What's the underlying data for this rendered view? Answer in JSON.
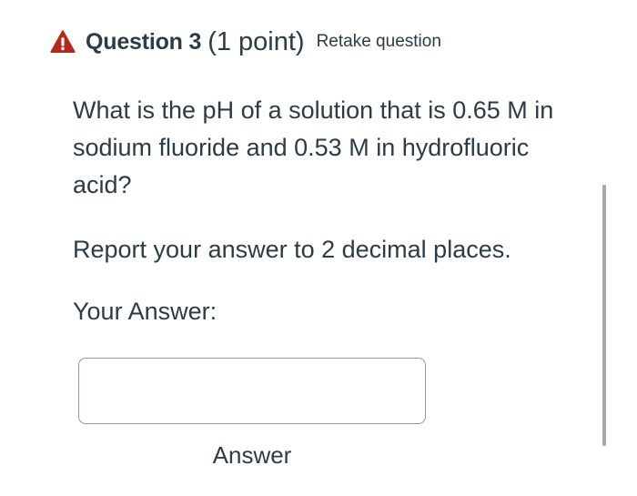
{
  "header": {
    "icon": "warning-triangle-icon",
    "icon_color": "#b12a1b",
    "title": "Question 3",
    "points": "(1 point)",
    "retake_label": "Retake question"
  },
  "question": {
    "text": "What is the pH of a solution that is 0.65 M in sodium fluoride and 0.53 M in hydrofluoric acid?",
    "instruction": "Report your answer to 2 decimal places."
  },
  "answer": {
    "label": "Your Answer:",
    "value": "",
    "placeholder": "",
    "caption": "Answer"
  },
  "colors": {
    "text": "#2d3b45",
    "input_border": "#8b969e",
    "scrollbar": "#a7a7a7"
  }
}
